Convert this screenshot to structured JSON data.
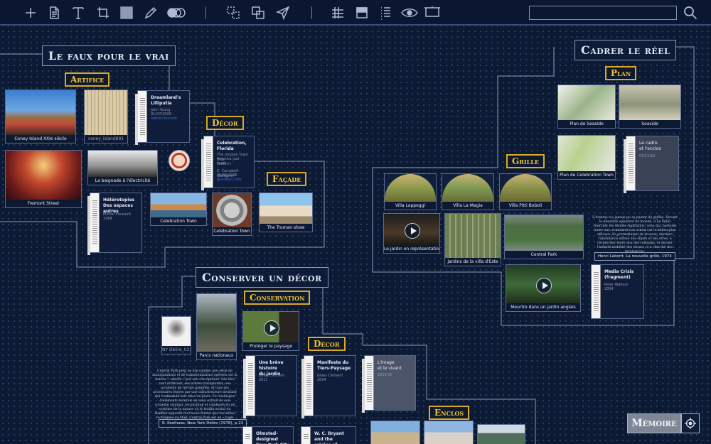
{
  "toolbar": {
    "search_placeholder": ""
  },
  "sections": {
    "faux": "Le faux pour le vrai",
    "cadrer": "Cadrer le réel",
    "conserver": "Conserver un décor"
  },
  "subsections": {
    "artifice": "Artifice",
    "decor1": "Décor",
    "facade": "Façade",
    "plan": "Plan",
    "grille": "Grille",
    "conservation": "Conservation",
    "decor2": "Décor",
    "enclos": "Enclos"
  },
  "images": {
    "coney": "Coney Island XXIe siècle",
    "coney2": "coney_island891",
    "fremont": "Fremont Street",
    "baignade": "La baignade à l'électricité",
    "celebration1": "Celebration Town",
    "celebration2": "Celebration Town",
    "truman": "The Truman show",
    "seaside_plan": "Plan de Seaside",
    "seaside": "Seaside",
    "celeb_plan": "Plan de Celebration Town",
    "lappeggi": "Villa Lappeggi",
    "magia": "Villa La Magia",
    "boboli": "Villa Pitti Boboli",
    "jardin_rep": "Le jardin en représentation",
    "este": "Jardins de la villa d'Este",
    "central": "Central Park",
    "meurtre": "Meurtre dans un jardin anglais",
    "ny_delire": "NY Délire_031",
    "parcs": "Parcs nationaux",
    "paysage": "Protéger le paysage"
  },
  "docs": {
    "dreamland": {
      "title": "Dreamland's Lilliputia",
      "meta": [
        "John Young",
        "01/07/2009",
        "Indirectioncom"
      ]
    },
    "celebration": {
      "title": "Celebration, Florida",
      "meta": [
        "The utopian town that",
        "America just couldn't",
        "trust",
        "",
        "K. Campbell-Gallagher",
        "20/06/2006",
        "guardian.com"
      ]
    },
    "heterotopies": {
      "title": "Hétérotopies\nDes espaces autres",
      "meta": [
        "Michel Foucault",
        "1984"
      ]
    },
    "cadre": {
      "title": "Le cadre\net l'enclos",
      "meta": [
        "01/12/16"
      ]
    },
    "media": {
      "title": "Media Crisis\n(fragment)",
      "meta": [
        "Peter Walters",
        "2004"
      ]
    },
    "histoire": {
      "title": "Une brève histoire\ndu jardin",
      "meta": [
        "Gilles Clément",
        "2011"
      ]
    },
    "tiers": {
      "title": "Manifeste du\nTiers-Paysage",
      "meta": [
        "Gilles Clément",
        "2004"
      ]
    },
    "image": {
      "title": "L'image\net le vivant",
      "meta": [
        "2019/16"
      ]
    },
    "olmsted": {
      "title": "Olmsted-designed\nNew York City parks",
      "meta": []
    },
    "bryant": {
      "title": "W. C. Bryant and the\norigins of Central Park",
      "meta": []
    }
  },
  "quotes": {
    "laborit": "L'homme n'a jamais pu se passer de grilles. Devant le désordre apparent du monde, il lui fallut chercher les termes signifiants, ceux qui, associés entre eux, rendaient son action sur le milieu plus efficace. Ils permettaient de trouver, derrière l'abondance infinie des objets et des êtres, à rechercher entre eux des relations, et devant l'infinité mobilité des choses, il a cherché des invariances.",
    "laborit_src": "Henri Laborit, La nouvelle grille, 1974",
    "koolhaas": "Central Park peut se lire comme une série de manipulations et de transformations opérées sur la nature « sauvée » par ses concepteurs. Ses lacs sont artificiels, ses arbres transplantés, ses accidents de terrain planifiés, et tous ses accessoires étayés par une infrastructure invisible qui commande leur mise en place. Un catalogue d'éléments naturels en ainsi extrait de son contexte original, reconstitué et condensé en un système de la nature où le feuillu modul du Ramble apparaît tout aussi formel que les allées rectilignes du Mall. Central Park est un « tapis d'Arcadie » synthétique.",
    "koolhaas_src": "R. Koolhaas, New York Délire (1978), p.22"
  },
  "memoire_label": "Mémoire",
  "icons": [
    "plus-icon",
    "document-icon",
    "text-icon",
    "frame-icon",
    "square-icon",
    "pen-icon",
    "circles-icon",
    "ungroup-icon",
    "group-icon",
    "send-icon",
    "grid-icon",
    "layout-icon",
    "list-icon",
    "eye-icon",
    "presentation-icon",
    "search-icon",
    "target-icon"
  ]
}
